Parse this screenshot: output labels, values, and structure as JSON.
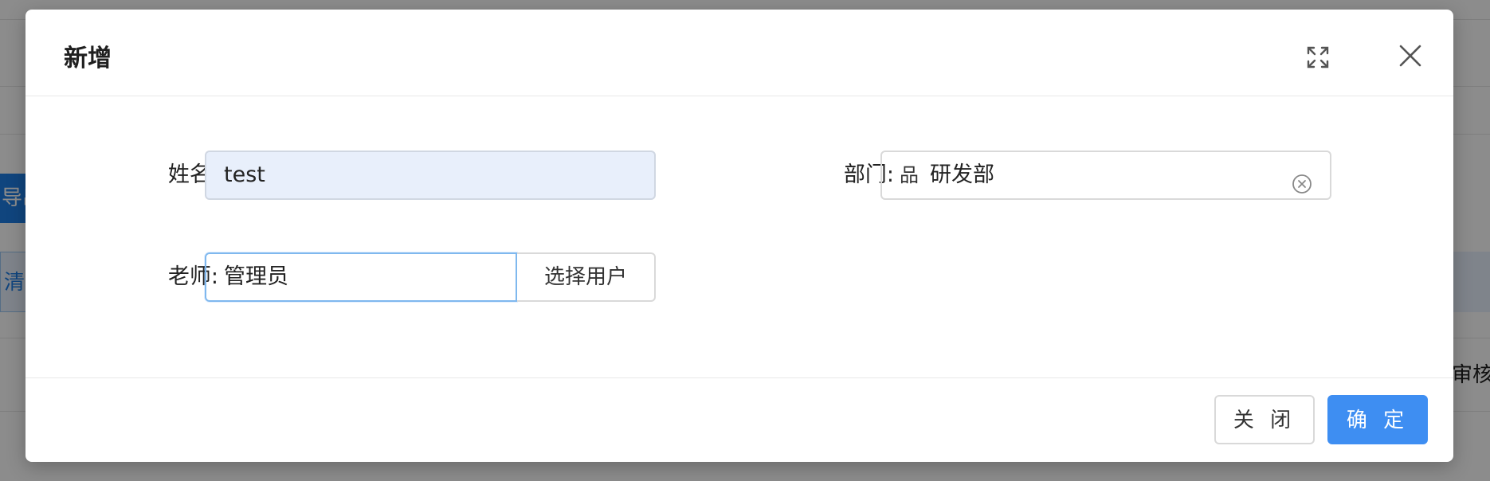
{
  "background": {
    "export_partial": "导出",
    "clear_partial": "清",
    "column_partial": "审核状"
  },
  "dialog": {
    "title": "新增",
    "icons": {
      "fullscreen": "fullscreen-icon",
      "close": "close-icon"
    },
    "form": {
      "name_label": "姓名:",
      "name_value": "test",
      "department_label": "部门:",
      "department_icon": "品",
      "department_value": "研发部",
      "teacher_label": "老师:",
      "teacher_value": "管理员",
      "select_user_button": "选择用户"
    },
    "footer": {
      "cancel_label": "关 闭",
      "ok_label": "确 定"
    }
  },
  "colors": {
    "primary": "#3e8ef2",
    "filled_input": "#e8effb",
    "mask": "rgba(0,0,0,0.45)"
  }
}
